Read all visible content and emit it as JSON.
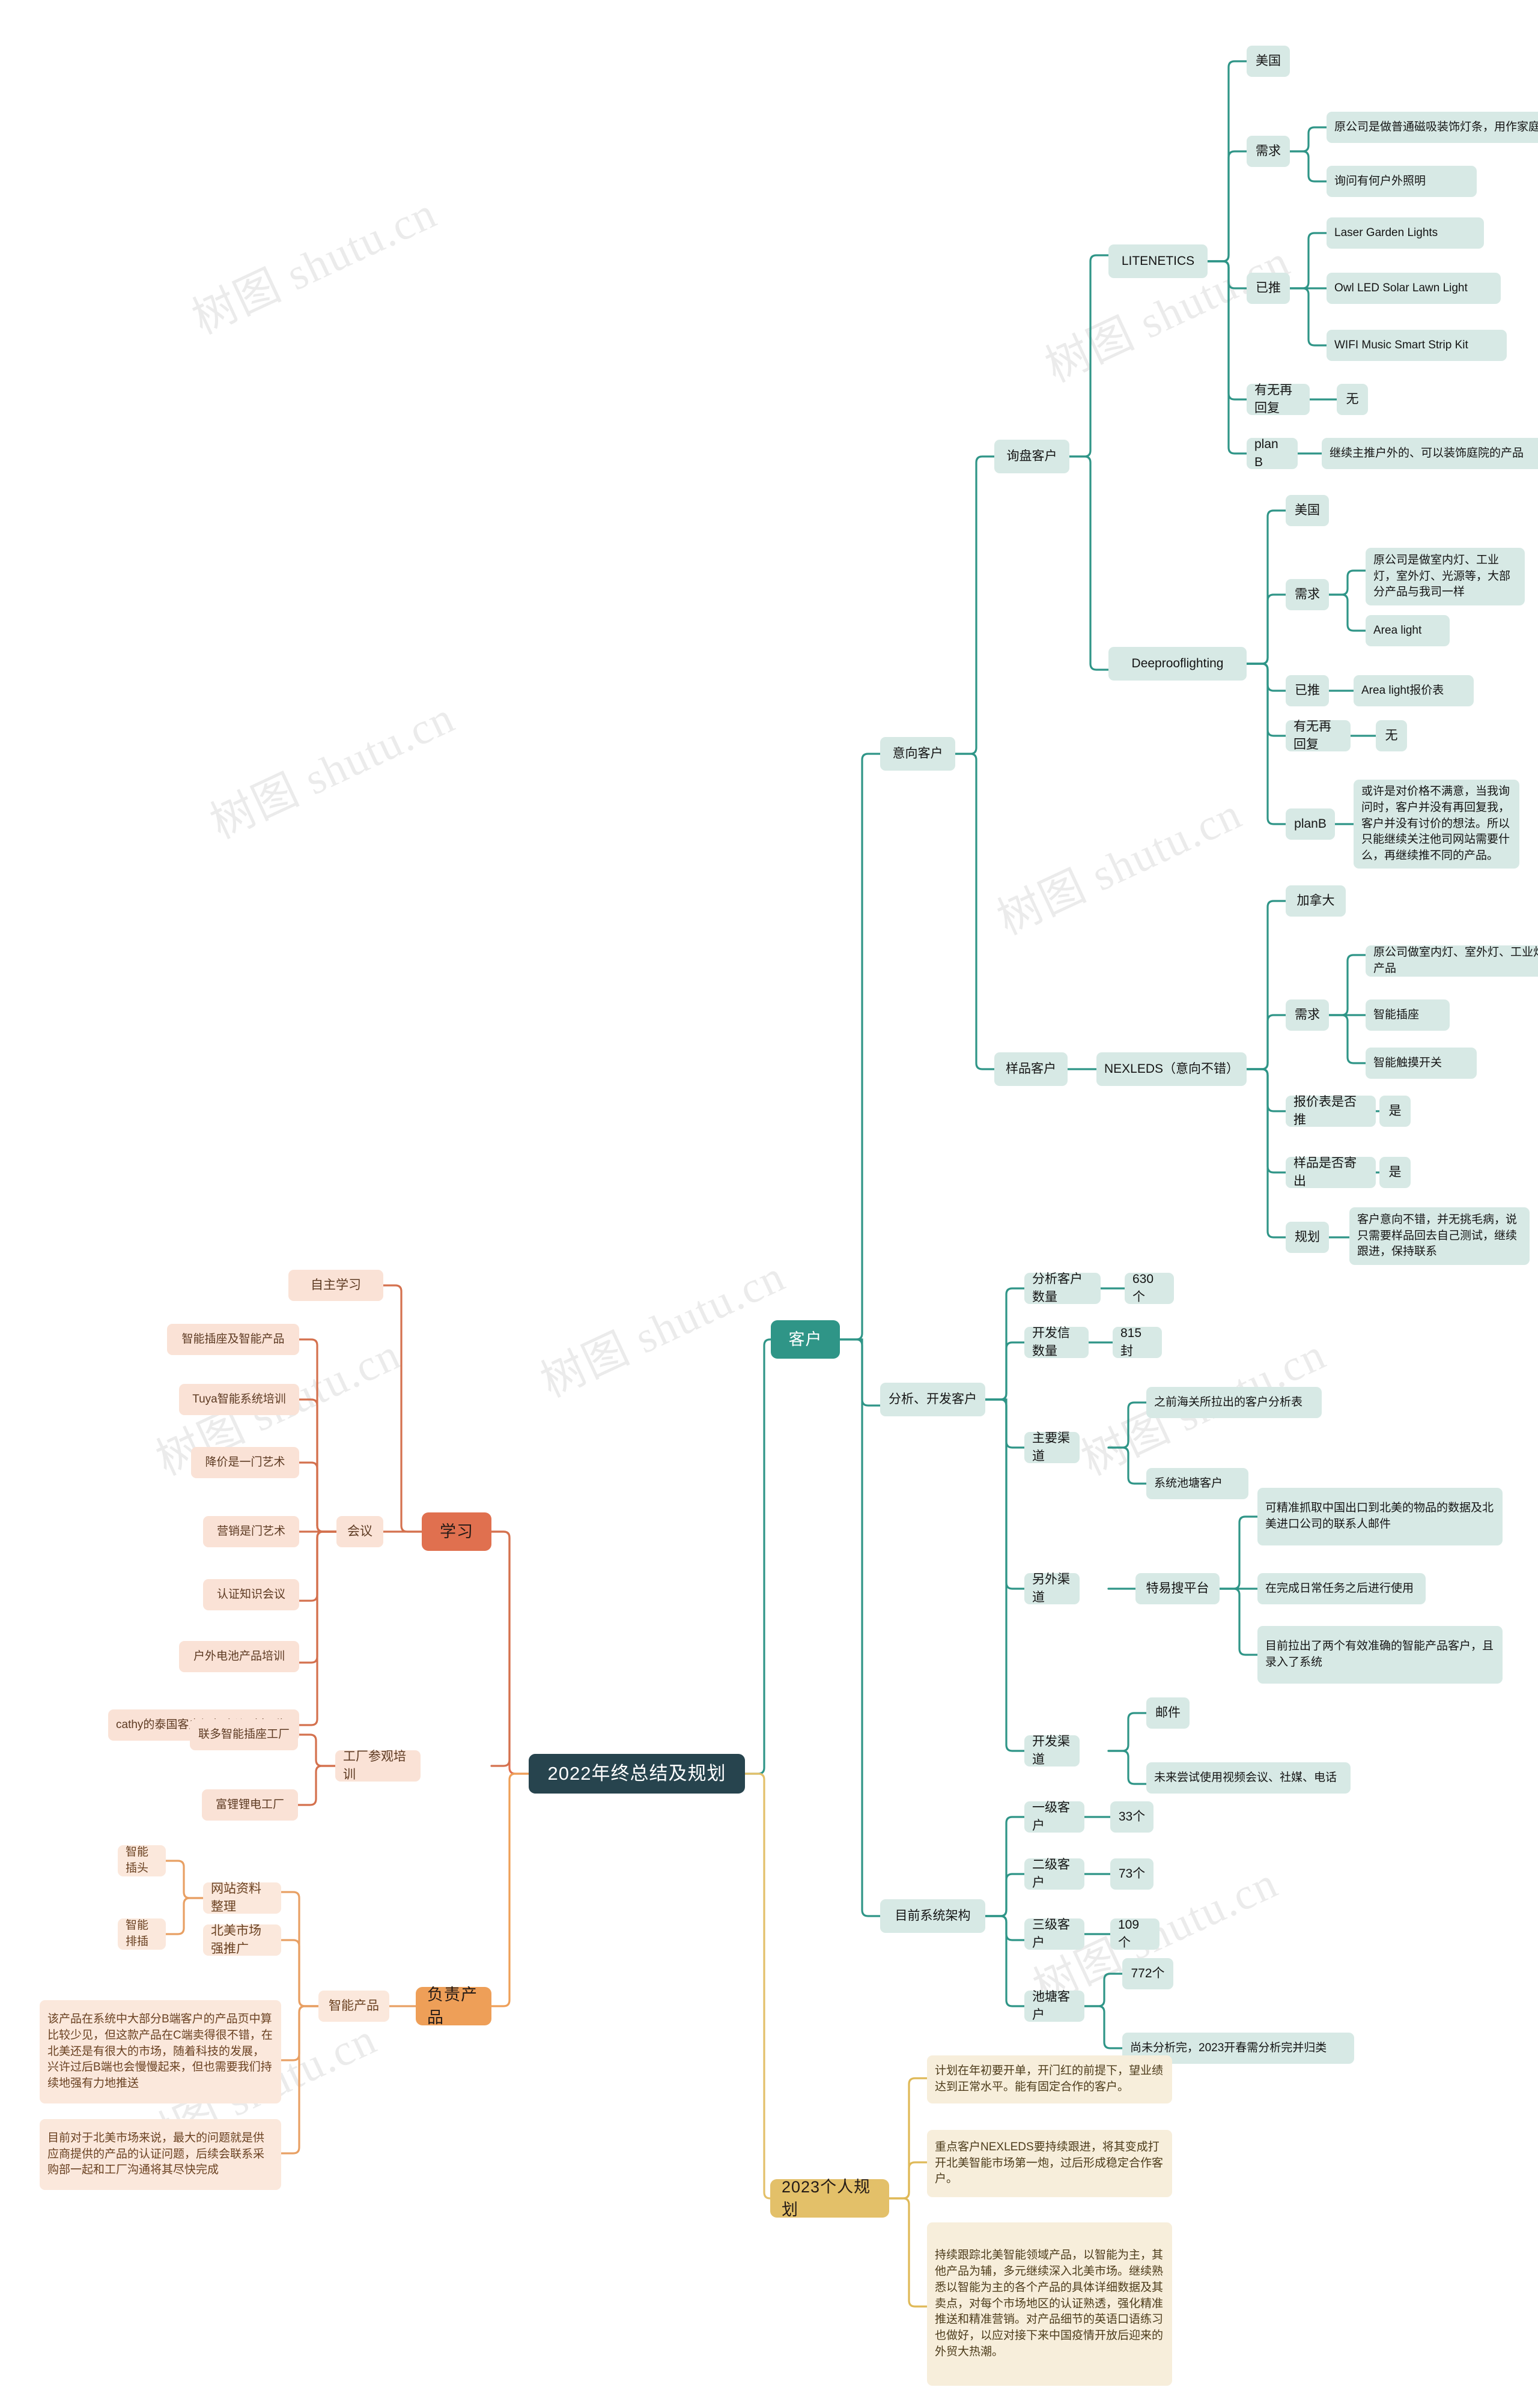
{
  "meta": {
    "root": "2022年终总结及规划",
    "watermark": "树图 shutu.cn"
  },
  "branches": {
    "kehu": {
      "label": "客户",
      "children": {
        "yixiang": {
          "label": "意向客户",
          "children": {
            "xunpan": {
              "label": "询盘客户",
              "children": {
                "litenetics": {
                  "label": "LITENETICS",
                  "country": "美国",
                  "xuqiu_label": "需求",
                  "xuqiu": [
                    "原公司是做普通磁吸装饰灯条，用作家庭庭院",
                    "询问有何户外照明"
                  ],
                  "yitui_label": "已推",
                  "yitui": [
                    "Laser Garden Lights",
                    "Owl LED Solar Lawn Light",
                    "WIFI Music Smart Strip Kit"
                  ],
                  "reply_label": "有无再回复",
                  "reply_value": "无",
                  "plan_label": "plan B",
                  "plan_value": "继续主推户外的、可以装饰庭院的产品"
                },
                "deeproof": {
                  "label": "Deeprooflighting",
                  "country": "美国",
                  "xuqiu_label": "需求",
                  "xuqiu": [
                    "原公司是做室内灯、工业灯，室外灯、光源等，大部分产品与我司一样",
                    "Area light"
                  ],
                  "yitui_label": "已推",
                  "yitui_value": "Area light报价表",
                  "reply_label": "有无再回复",
                  "reply_value": "无",
                  "plan_label": "planB",
                  "plan_value": "或许是对价格不满意，当我询问时，客户并没有再回复我，客户并没有讨价的想法。所以只能继续关注他司网站需要什么，再继续推不同的产品。"
                }
              }
            },
            "yangpin": {
              "label": "样品客户",
              "nexleds": {
                "label": "NEXLEDS（意向不错）",
                "country": "加拿大",
                "xuqiu_label": "需求",
                "xuqiu": [
                  "原公司做室内灯、室外灯、工业灯、智能产品",
                  "智能插座",
                  "智能触摸开关"
                ],
                "quote_label": "报价表是否推",
                "quote_value": "是",
                "sample_label": "样品是否寄出",
                "sample_value": "是",
                "plan_label": "规划",
                "plan_value": "客户意向不错，并无挑毛病，说只需要样品回去自己测试，继续跟进，保持联系"
              }
            }
          }
        },
        "fenxi": {
          "label": "分析、开发客户",
          "count_label": "分析客户数量",
          "count_value": "630个",
          "letters_label": "开发信数量",
          "letters_value": "815封",
          "main_channel_label": "主要渠道",
          "main_channel": [
            "之前海关所拉出的客户分析表",
            "系统池塘客户"
          ],
          "other_channel_label": "另外渠道",
          "other_channel_platform": "特易搜平台",
          "other_channel_items": [
            "可精准抓取中国出口到北美的物品的数据及北美进口公司的联系人邮件",
            "在完成日常任务之后进行使用",
            "目前拉出了两个有效准确的智能产品客户，且录入了系统"
          ],
          "dev_channel_label": "开发渠道",
          "dev_channel": [
            "邮件",
            "未来尝试使用视频会议、社媒、电话"
          ]
        },
        "jiagou": {
          "label": "目前系统架构",
          "levels": [
            {
              "label": "一级客户",
              "value": "33个"
            },
            {
              "label": "二级客户",
              "value": "73个"
            },
            {
              "label": "三级客户",
              "value": "109个"
            }
          ],
          "pond_label": "池塘客户",
          "pond_items": [
            "772个",
            "尚未分析完，2023开春需分析完并归类"
          ]
        }
      }
    },
    "xuexi": {
      "label": "学习",
      "zizhu": "自主学习",
      "huiyi_label": "会议",
      "huiyi_items": [
        "智能插座及智能产品",
        "Tuya智能系统培训",
        "降价是一门艺术",
        "营销是门艺术",
        "认证知识会议",
        "户外电池产品培训",
        "cathy的泰国客户视频会议（旁听）"
      ],
      "gongchang_label": "工厂参观培训",
      "gongchang_items": [
        "联多智能插座工厂",
        "富锂锂电工厂"
      ]
    },
    "chanpin": {
      "label": "负责产品",
      "zhineng_label": "智能产品",
      "website_label": "网站资料整理",
      "website_items": [
        "智能插头",
        "智能排插"
      ],
      "promo_label": "北美市场强推广",
      "notes": [
        "该产品在系统中大部分B端客户的产品页中算比较少见，但这款产品在C端卖得很不错，在北美还是有很大的市场，随着科技的发展，兴许过后B端也会慢慢起来，但也需要我们持续地强有力地推送",
        "目前对于北美市场来说，最大的问题就是供应商提供的产品的认证问题，后续会联系采购部一起和工厂沟通将其尽快完成"
      ]
    },
    "guihua2023": {
      "label": "2023个人规划",
      "items": [
        "计划在年初要开单，开门红的前提下，望业绩达到正常水平。能有固定合作的客户。",
        "重点客户NEXLEDS要持续跟进，将其变成打开北美智能市场第一炮，过后形成稳定合作客户。",
        "持续跟踪北美智能领域产品，以智能为主，其他产品为辅，多元继续深入北美市场。继续熟悉以智能为主的各个产品的具体详细数据及其卖点，对每个市场地区的认证熟透，强化精准推送和精准营销。对产品细节的英语口语练习也做好，以应对接下来中国疫情开放后迎来的外贸大热潮。"
      ]
    }
  },
  "colors": {
    "root": "#27444e",
    "customer_branch": "#2f9587",
    "learning_branch": "#e0704f",
    "product_branch": "#ee9f58",
    "plan_branch": "#e3c069",
    "leaf_green": "#d7e9e5",
    "leaf_orange": "#fae2d6",
    "leaf_gold": "#f7eedb"
  }
}
